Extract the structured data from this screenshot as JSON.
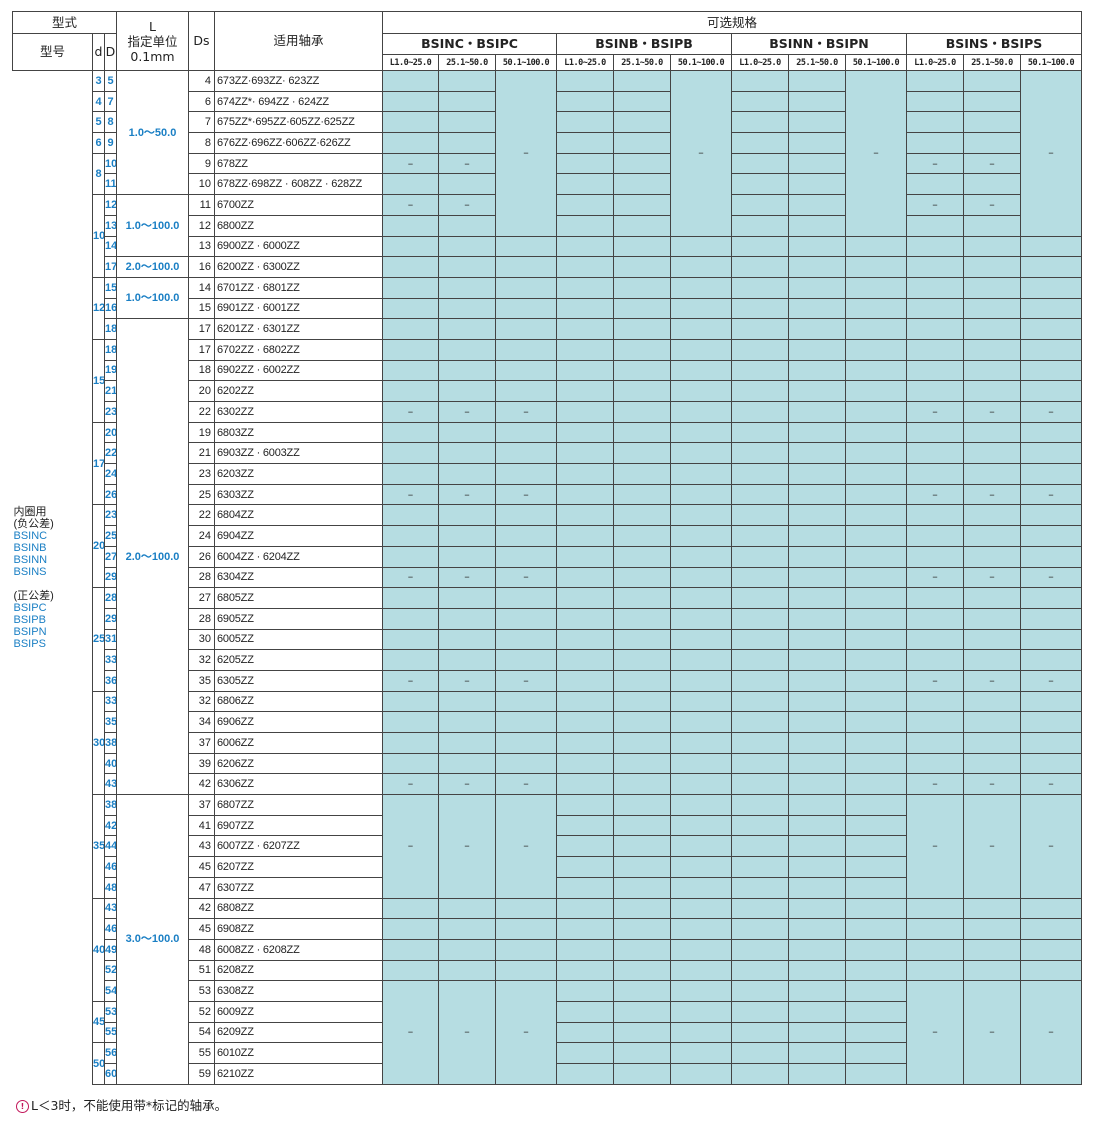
{
  "header": {
    "style_label": "型式",
    "model_label": "型号",
    "d_label": "d",
    "D_label": "D",
    "L_label": "L",
    "L_sub1": "指定单位",
    "L_sub2": "0.1mm",
    "Ds_label": "Ds",
    "bearing_label": "适用轴承",
    "options_label": "可选规格",
    "groups": [
      "BSINC・BSIPC",
      "BSINB・BSIPB",
      "BSINN・BSIPN",
      "BSINS・BSIPS"
    ],
    "ranges": [
      "L1.0~25.0",
      "25.1~50.0",
      "50.1~100.0"
    ]
  },
  "type_cell": {
    "neg_title": "内圈用",
    "neg_note": "(负公差)",
    "neg_models": [
      "BSINC",
      "BSINB",
      "BSINN",
      "BSINS"
    ],
    "pos_note": "(正公差)",
    "pos_models": [
      "BSIPC",
      "BSIPB",
      "BSIPN",
      "BSIPS"
    ]
  },
  "d_groups": [
    {
      "d": "3",
      "rows": 1
    },
    {
      "d": "4",
      "rows": 1
    },
    {
      "d": "5",
      "rows": 1
    },
    {
      "d": "6",
      "rows": 1
    },
    {
      "d": "8",
      "rows": 2
    },
    {
      "d": "10",
      "rows": 4
    },
    {
      "d": "12",
      "rows": 3
    },
    {
      "d": "15",
      "rows": 4
    },
    {
      "d": "17",
      "rows": 4
    },
    {
      "d": "20",
      "rows": 4
    },
    {
      "d": "25",
      "rows": 5
    },
    {
      "d": "30",
      "rows": 5
    },
    {
      "d": "35",
      "rows": 5
    },
    {
      "d": "40",
      "rows": 5
    },
    {
      "d": "45",
      "rows": 2
    },
    {
      "d": "50",
      "rows": 2
    }
  ],
  "l_ranges": [
    {
      "label": "1.0～50.0",
      "rows": 6
    },
    {
      "label": "1.0～100.0",
      "rows": 3
    },
    {
      "label": "2.0～100.0",
      "rows": 1
    },
    {
      "label": "1.0～100.0",
      "rows": 2
    },
    {
      "label": "2.0～100.0",
      "rows": 23
    },
    {
      "label": "3.0～100.0",
      "rows": 16
    }
  ],
  "rows": [
    {
      "D": "5",
      "Ds": "4",
      "bearing": "673ZZ·693ZZ· 623ZZ"
    },
    {
      "D": "7",
      "Ds": "6",
      "bearing": "674ZZ*· 694ZZ · 624ZZ"
    },
    {
      "D": "8",
      "Ds": "7",
      "bearing": "675ZZ*·695ZZ·605ZZ·625ZZ"
    },
    {
      "D": "9",
      "Ds": "8",
      "bearing": "676ZZ·696ZZ·606ZZ·626ZZ"
    },
    {
      "D": "10",
      "Ds": "9",
      "bearing": "678ZZ"
    },
    {
      "D": "11",
      "Ds": "10",
      "bearing": "678ZZ·698ZZ · 608ZZ · 628ZZ"
    },
    {
      "D": "12",
      "Ds": "11",
      "bearing": "6700ZZ"
    },
    {
      "D": "13",
      "Ds": "12",
      "bearing": "6800ZZ"
    },
    {
      "D": "14",
      "Ds": "13",
      "bearing": "6900ZZ · 6000ZZ"
    },
    {
      "D": "17",
      "Ds": "16",
      "bearing": "6200ZZ · 6300ZZ"
    },
    {
      "D": "15",
      "Ds": "14",
      "bearing": "6701ZZ · 6801ZZ"
    },
    {
      "D": "16",
      "Ds": "15",
      "bearing": "6901ZZ · 6001ZZ"
    },
    {
      "D": "18",
      "Ds": "17",
      "bearing": "6201ZZ · 6301ZZ"
    },
    {
      "D": "18",
      "Ds": "17",
      "bearing": "6702ZZ · 6802ZZ"
    },
    {
      "D": "19",
      "Ds": "18",
      "bearing": "6902ZZ · 6002ZZ"
    },
    {
      "D": "21",
      "Ds": "20",
      "bearing": "6202ZZ"
    },
    {
      "D": "23",
      "Ds": "22",
      "bearing": "6302ZZ"
    },
    {
      "D": "20",
      "Ds": "19",
      "bearing": "6803ZZ"
    },
    {
      "D": "22",
      "Ds": "21",
      "bearing": "6903ZZ · 6003ZZ"
    },
    {
      "D": "24",
      "Ds": "23",
      "bearing": "6203ZZ"
    },
    {
      "D": "26",
      "Ds": "25",
      "bearing": "6303ZZ"
    },
    {
      "D": "23",
      "Ds": "22",
      "bearing": "6804ZZ"
    },
    {
      "D": "25",
      "Ds": "24",
      "bearing": "6904ZZ"
    },
    {
      "D": "27",
      "Ds": "26",
      "bearing": "6004ZZ · 6204ZZ"
    },
    {
      "D": "29",
      "Ds": "28",
      "bearing": "6304ZZ"
    },
    {
      "D": "28",
      "Ds": "27",
      "bearing": "6805ZZ"
    },
    {
      "D": "29",
      "Ds": "28",
      "bearing": "6905ZZ"
    },
    {
      "D": "31",
      "Ds": "30",
      "bearing": "6005ZZ"
    },
    {
      "D": "33",
      "Ds": "32",
      "bearing": "6205ZZ"
    },
    {
      "D": "36",
      "Ds": "35",
      "bearing": "6305ZZ"
    },
    {
      "D": "33",
      "Ds": "32",
      "bearing": "6806ZZ"
    },
    {
      "D": "35",
      "Ds": "34",
      "bearing": "6906ZZ"
    },
    {
      "D": "38",
      "Ds": "37",
      "bearing": "6006ZZ"
    },
    {
      "D": "40",
      "Ds": "39",
      "bearing": "6206ZZ"
    },
    {
      "D": "43",
      "Ds": "42",
      "bearing": "6306ZZ"
    },
    {
      "D": "38",
      "Ds": "37",
      "bearing": "6807ZZ"
    },
    {
      "D": "42",
      "Ds": "41",
      "bearing": "6907ZZ"
    },
    {
      "D": "44",
      "Ds": "43",
      "bearing": "6007ZZ · 6207ZZ"
    },
    {
      "D": "46",
      "Ds": "45",
      "bearing": "6207ZZ"
    },
    {
      "D": "48",
      "Ds": "47",
      "bearing": "6307ZZ"
    },
    {
      "D": "43",
      "Ds": "42",
      "bearing": "6808ZZ"
    },
    {
      "D": "46",
      "Ds": "45",
      "bearing": "6908ZZ"
    },
    {
      "D": "49",
      "Ds": "48",
      "bearing": "6008ZZ · 6208ZZ"
    },
    {
      "D": "52",
      "Ds": "51",
      "bearing": "6208ZZ"
    },
    {
      "D": "54",
      "Ds": "53",
      "bearing": "6308ZZ"
    },
    {
      "D": "53",
      "Ds": "52",
      "bearing": "6009ZZ"
    },
    {
      "D": "55",
      "Ds": "54",
      "bearing": "6209ZZ"
    },
    {
      "D": "56",
      "Ds": "55",
      "bearing": "6010ZZ"
    },
    {
      "D": "60",
      "Ds": "59",
      "bearing": "6210ZZ"
    }
  ],
  "dash": "–",
  "top_merged": {
    "start": 0,
    "end": 7,
    "dash_row": 3,
    "dash_rows_12": [
      4,
      6
    ]
  },
  "dash_rows_all": [
    16,
    20,
    24,
    29,
    34
  ],
  "bottom_merged_a": {
    "start": 35,
    "end": 39,
    "dash_row": 38
  },
  "bottom_merged_b": {
    "start": 44,
    "end": 48,
    "dash_row": 46
  },
  "note": "L＜3时，不能使用带*标记的轴承。"
}
